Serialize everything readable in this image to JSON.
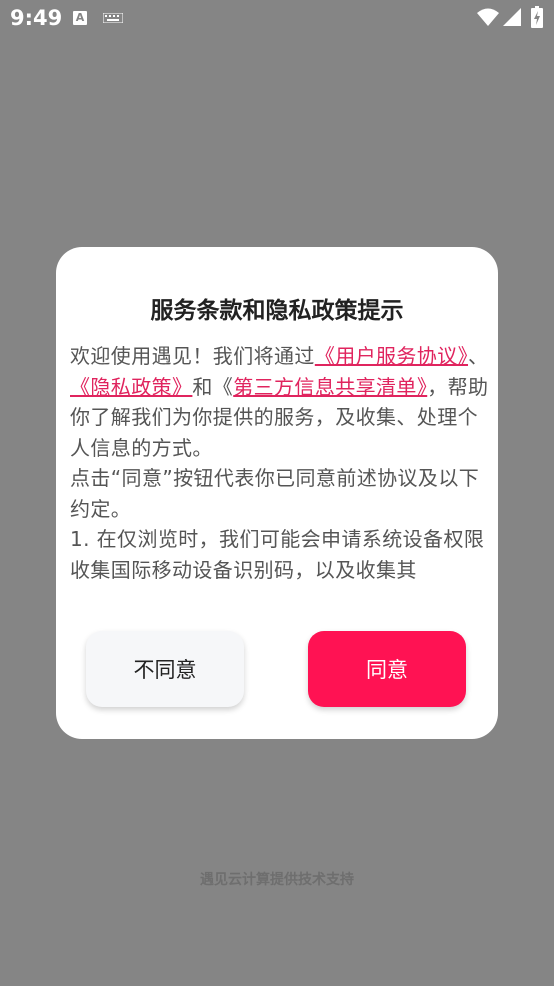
{
  "status_bar": {
    "time": "9:49",
    "a_icon_letter": "A",
    "icons": [
      "a-icon",
      "keyboard-icon",
      "wifi-icon",
      "signal-icon",
      "battery-icon"
    ]
  },
  "dialog": {
    "title": "服务条款和隐私政策提示",
    "body": {
      "intro": "欢迎使用遇见！我们将通过",
      "link_user_agreement": "《用户服务协议》",
      "sep1": "、",
      "link_privacy": "《隐私政策》",
      "sep2": "和《",
      "link_third_party": "第三方信息共享清单》",
      "after_links": "，帮助你了解我们为你提供的服务，及收集、处理个人信息的方式。",
      "para2": " 点击“同意”按钮代表你已同意前述协议及以下约定。",
      "para3": " 1. 在仅浏览时，我们可能会申请系统设备权限收集国际移动设备识别码，以及收集其"
    },
    "buttons": {
      "disagree": "不同意",
      "agree": "同意"
    }
  },
  "footer": {
    "text": "遇见云计算提供技术支持"
  },
  "colors": {
    "overlay": "#858585",
    "accent": "#ff1253",
    "link": "#e0245e"
  }
}
